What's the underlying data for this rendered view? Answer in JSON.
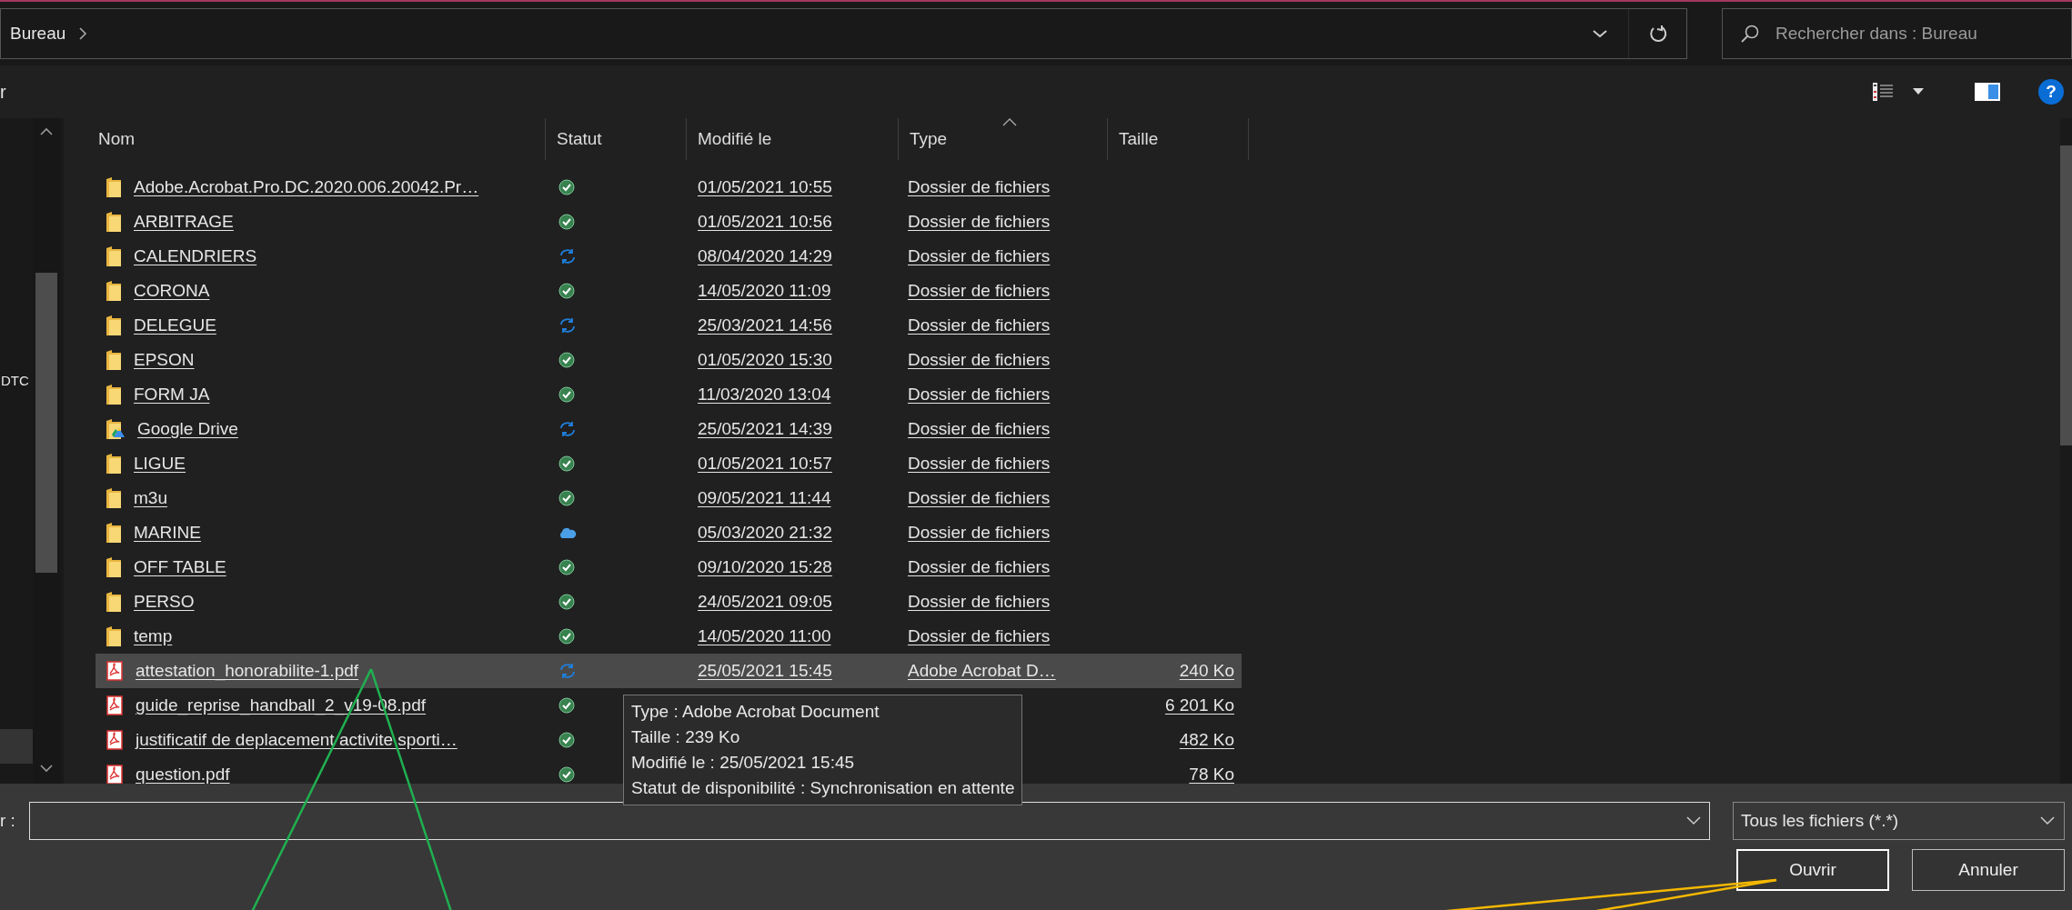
{
  "address": {
    "crumb": "Bureau"
  },
  "search": {
    "placeholder": "Rechercher dans : Bureau"
  },
  "toolbar": {
    "cut_label": "r",
    "help": "?"
  },
  "nav": {
    "cut_label": "DTC"
  },
  "columns": [
    {
      "label": "Nom",
      "sorted": false
    },
    {
      "label": "Statut",
      "sorted": false
    },
    {
      "label": "Modifié le",
      "sorted": false
    },
    {
      "label": "Type",
      "sorted": true
    },
    {
      "label": "Taille",
      "sorted": false
    }
  ],
  "rows": [
    {
      "kind": "folder",
      "name": "Adobe.Acrobat.Pro.DC.2020.006.20042.Pr…",
      "status": {
        "kind": "synced"
      },
      "modified": "01/05/2021 10:55",
      "type": "Dossier de fichiers",
      "selected": false
    },
    {
      "kind": "folder",
      "name": "ARBITRAGE",
      "status": {
        "kind": "synced"
      },
      "modified": "01/05/2021 10:56",
      "type": "Dossier de fichiers",
      "selected": false
    },
    {
      "kind": "folder",
      "name": "CALENDRIERS",
      "status": {
        "kind": "syncing"
      },
      "modified": "08/04/2020 14:29",
      "type": "Dossier de fichiers",
      "selected": false
    },
    {
      "kind": "folder",
      "name": "CORONA",
      "status": {
        "kind": "synced"
      },
      "modified": "14/05/2020 11:09",
      "type": "Dossier de fichiers",
      "selected": false
    },
    {
      "kind": "folder",
      "name": "DELEGUE",
      "status": {
        "kind": "syncing"
      },
      "modified": "25/03/2021 14:56",
      "type": "Dossier de fichiers",
      "selected": false
    },
    {
      "kind": "folder",
      "name": "EPSON",
      "status": {
        "kind": "synced"
      },
      "modified": "01/05/2020 15:30",
      "type": "Dossier de fichiers",
      "selected": false
    },
    {
      "kind": "folder",
      "name": "FORM JA",
      "status": {
        "kind": "synced"
      },
      "modified": "11/03/2020 13:04",
      "type": "Dossier de fichiers",
      "selected": false
    },
    {
      "kind": "drive",
      "name": "Google Drive",
      "status": {
        "kind": "syncing"
      },
      "modified": "25/05/2021 14:39",
      "type": "Dossier de fichiers",
      "selected": false
    },
    {
      "kind": "folder",
      "name": "LIGUE",
      "status": {
        "kind": "synced"
      },
      "modified": "01/05/2021 10:57",
      "type": "Dossier de fichiers",
      "selected": false
    },
    {
      "kind": "folder",
      "name": "m3u",
      "status": {
        "kind": "synced"
      },
      "modified": "09/05/2021 11:44",
      "type": "Dossier de fichiers",
      "selected": false
    },
    {
      "kind": "folder",
      "name": "MARINE",
      "status": {
        "kind": "cloud"
      },
      "modified": "05/03/2020 21:32",
      "type": "Dossier de fichiers",
      "selected": false
    },
    {
      "kind": "folder",
      "name": "OFF TABLE",
      "status": {
        "kind": "synced"
      },
      "modified": "09/10/2020 15:28",
      "type": "Dossier de fichiers",
      "selected": false
    },
    {
      "kind": "folder",
      "name": "PERSO",
      "status": {
        "kind": "synced"
      },
      "modified": "24/05/2021 09:05",
      "type": "Dossier de fichiers",
      "selected": false
    },
    {
      "kind": "folder",
      "name": "temp",
      "status": {
        "kind": "synced"
      },
      "modified": "14/05/2020 11:00",
      "type": "Dossier de fichiers",
      "selected": false
    },
    {
      "kind": "pdf",
      "name": "attestation_honorabilite-1.pdf",
      "status": {
        "kind": "syncing"
      },
      "modified": "25/05/2021 15:45",
      "type": "Adobe Acrobat D…",
      "size": "240 Ko",
      "selected": true
    },
    {
      "kind": "pdf",
      "name": "guide_reprise_handball_2_v19-08.pdf",
      "status": {
        "kind": "synced"
      },
      "size": "6 201 Ko",
      "selected": false
    },
    {
      "kind": "pdf",
      "name": "justificatif de deplacement activite sporti…",
      "status": {
        "kind": "synced"
      },
      "size": "482 Ko",
      "selected": false
    },
    {
      "kind": "pdf",
      "name": "question.pdf",
      "status": {
        "kind": "synced"
      },
      "size": "78 Ko",
      "selected": false
    }
  ],
  "tooltip": {
    "lines": [
      "Type : Adobe Acrobat Document",
      "Taille : 239 Ko",
      "Modifié le : 25/05/2021 15:45",
      "Statut de disponibilité : Synchronisation en attente"
    ]
  },
  "filename": {
    "label": "r :"
  },
  "filetype": {
    "value": "Tous les fichiers (*.*)"
  },
  "buttons": [
    {
      "label": "Ouvrir",
      "focused": true
    },
    {
      "label": "Annuler",
      "focused": false
    }
  ]
}
